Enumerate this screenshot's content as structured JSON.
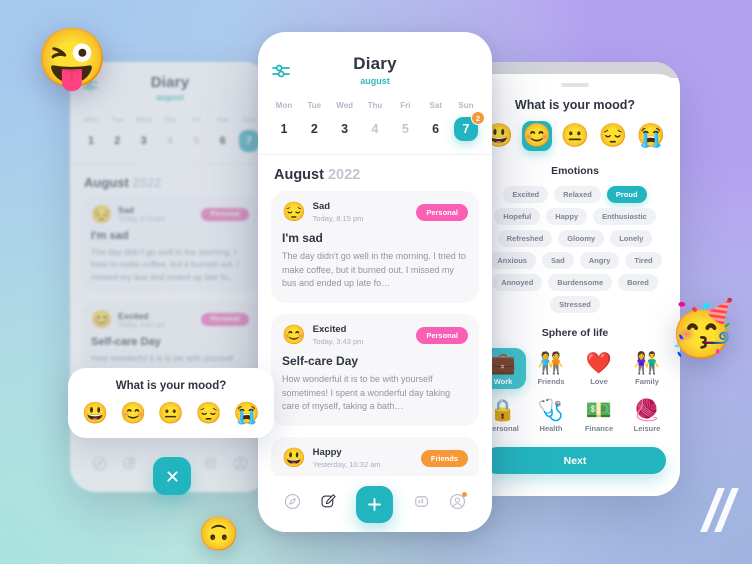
{
  "app": {
    "accent": "#23b5bf",
    "pink": "#f85fb5",
    "orange": "#f79838",
    "title": "Diary",
    "subtitle": "august"
  },
  "left_phone": {
    "header": {
      "title": "Diary",
      "subtitle": "august",
      "filter_icon": "sliders-icon"
    },
    "weekdays": [
      "Mon",
      "Tue",
      "Wed",
      "Thu",
      "Fri",
      "Sat",
      "Sun"
    ],
    "dates": [
      {
        "num": "1",
        "state": "normal"
      },
      {
        "num": "2",
        "state": "normal"
      },
      {
        "num": "3",
        "state": "normal"
      },
      {
        "num": "4",
        "state": "muted"
      },
      {
        "num": "5",
        "state": "muted"
      },
      {
        "num": "6",
        "state": "normal"
      },
      {
        "num": "7",
        "state": "selected"
      }
    ],
    "month": "August",
    "year": "2022",
    "entries": [
      {
        "emoji": "😔",
        "mood": "Sad",
        "time": "Today, 8:15 pm",
        "tag": "Personal",
        "title": "I'm sad",
        "body": "The day didn't go well in the morning. I tried to make coffee, but it burned out. I missed my bus and ended up late fo..."
      },
      {
        "emoji": "😊",
        "mood": "Excited",
        "time": "Today, 3:43 pm",
        "tag": "Personal",
        "title": "Self-care Day",
        "body": "How wonderful it is to be with yourself"
      }
    ],
    "mood_sheet": {
      "question": "What is your mood?",
      "moods": [
        "😃",
        "😊",
        "😐",
        "😔",
        "😭"
      ]
    },
    "close_label": "×",
    "nav": [
      "compass-icon",
      "edit-icon",
      "close-icon",
      "stats-icon",
      "profile-icon"
    ]
  },
  "center_phone": {
    "header": {
      "title": "Diary",
      "subtitle": "august",
      "filter_icon": "sliders-icon"
    },
    "weekdays": [
      "Mon",
      "Tue",
      "Wed",
      "Thu",
      "Fri",
      "Sat",
      "Sun"
    ],
    "dates": [
      {
        "num": "1",
        "state": "normal",
        "badge": ""
      },
      {
        "num": "2",
        "state": "normal",
        "badge": ""
      },
      {
        "num": "3",
        "state": "normal",
        "badge": ""
      },
      {
        "num": "4",
        "state": "muted",
        "badge": ""
      },
      {
        "num": "5",
        "state": "muted",
        "badge": ""
      },
      {
        "num": "6",
        "state": "normal",
        "badge": ""
      },
      {
        "num": "7",
        "state": "selected",
        "badge": "2"
      }
    ],
    "month": "August",
    "year": "2022",
    "entries": [
      {
        "emoji": "😔",
        "mood": "Sad",
        "time": "Today, 8:15 pm",
        "tag": "Personal",
        "tag_kind": "personal",
        "title": "I'm sad",
        "body": "The day didn't go well in the morning. I tried to make coffee, but it burned out. I missed my bus and ended up late fo…"
      },
      {
        "emoji": "😊",
        "mood": "Excited",
        "time": "Today, 3:43 pm",
        "tag": "Personal",
        "tag_kind": "personal",
        "title": "Self-care Day",
        "body": "How wonderful it is to be with yourself sometimes! I spent a wonderful day taking care of myself, taking a bath…"
      },
      {
        "emoji": "😃",
        "mood": "Happy",
        "time": "Yesterday, 10:32 am",
        "tag": "Friends",
        "tag_kind": "friends",
        "title": "",
        "body": ""
      }
    ],
    "nav": [
      "compass-icon",
      "edit-icon",
      "add-icon",
      "stats-icon",
      "profile-icon"
    ]
  },
  "right_phone": {
    "question": "What is your mood?",
    "moods": [
      {
        "emoji": "😃",
        "name": "very-happy",
        "selected": false
      },
      {
        "emoji": "😊",
        "name": "happy",
        "selected": true
      },
      {
        "emoji": "😐",
        "name": "neutral",
        "selected": false
      },
      {
        "emoji": "😔",
        "name": "sad",
        "selected": false
      },
      {
        "emoji": "😭",
        "name": "crying",
        "selected": false
      }
    ],
    "emotions_title": "Emotions",
    "emotions": [
      {
        "label": "Excited",
        "selected": false
      },
      {
        "label": "Relaxed",
        "selected": false
      },
      {
        "label": "Proud",
        "selected": true
      },
      {
        "label": "Hopeful",
        "selected": false
      },
      {
        "label": "Happy",
        "selected": false
      },
      {
        "label": "Enthusiastic",
        "selected": false
      },
      {
        "label": "Refreshed",
        "selected": false
      },
      {
        "label": "Gloomy",
        "selected": false
      },
      {
        "label": "Lonely",
        "selected": false
      },
      {
        "label": "Anxious",
        "selected": false
      },
      {
        "label": "Sad",
        "selected": false
      },
      {
        "label": "Angry",
        "selected": false
      },
      {
        "label": "Tired",
        "selected": false
      },
      {
        "label": "Annoyed",
        "selected": false
      },
      {
        "label": "Burdensome",
        "selected": false
      },
      {
        "label": "Bored",
        "selected": false
      },
      {
        "label": "Stressed",
        "selected": false
      }
    ],
    "sphere_title": "Sphere of life",
    "spheres": [
      {
        "label": "Work",
        "emoji": "💼",
        "selected": true
      },
      {
        "label": "Friends",
        "emoji": "🧑‍🤝‍🧑",
        "selected": false
      },
      {
        "label": "Love",
        "emoji": "❤️",
        "selected": false
      },
      {
        "label": "Family",
        "emoji": "👫",
        "selected": false
      },
      {
        "label": "Personal",
        "emoji": "🔒",
        "selected": false
      },
      {
        "label": "Health",
        "emoji": "🩺",
        "selected": false
      },
      {
        "label": "Finance",
        "emoji": "💵",
        "selected": false
      },
      {
        "label": "Leisure",
        "emoji": "🧶",
        "selected": false
      }
    ],
    "next_label": "Next"
  },
  "decor": {
    "emoji_top_left": "😜",
    "emoji_right": "🥳",
    "emoji_bottom": "🙃"
  }
}
